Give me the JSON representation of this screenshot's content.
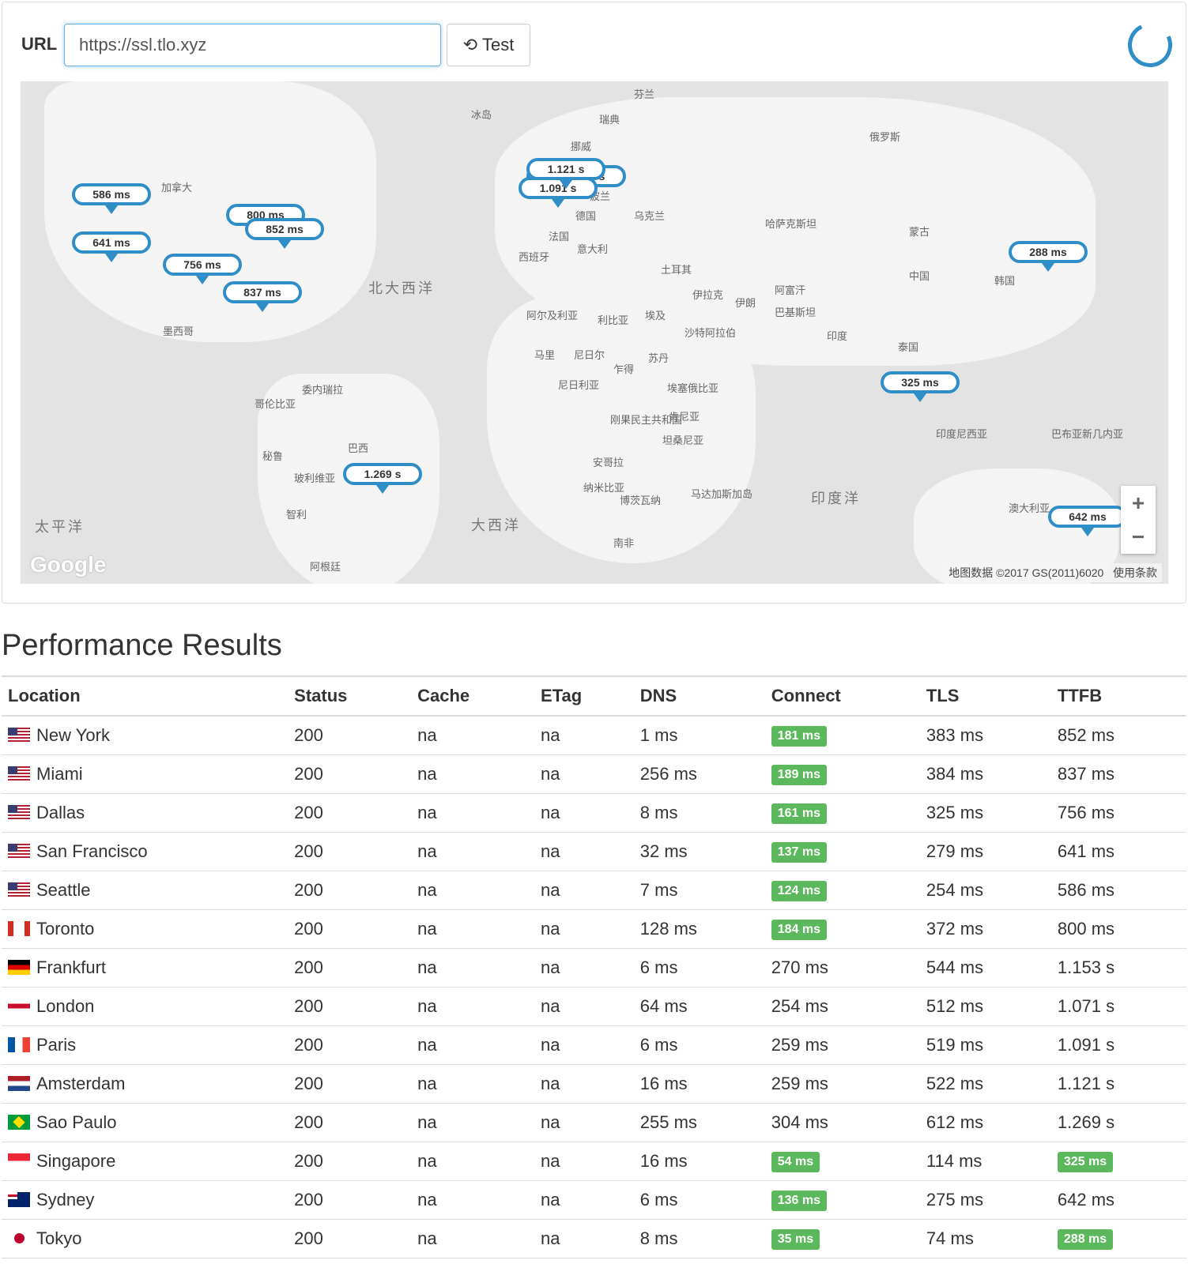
{
  "toolbar": {
    "url_label": "URL",
    "url_value": "https://ssl.tlo.xyz",
    "test_label": "Test",
    "test_icon": "history-icon",
    "loading_icon": "spinner"
  },
  "map": {
    "markers": [
      "586 ms",
      "641 ms",
      "800 ms",
      "852 ms",
      "756 ms",
      "837 ms",
      "1.153 s",
      "1.071 s",
      "1.091 s",
      "1.121 s",
      "1.269 s",
      "325 ms",
      "288 ms",
      "642 ms"
    ],
    "labels": [
      "冰岛",
      "芬兰",
      "瑞典",
      "挪威",
      "俄罗斯",
      "加拿大",
      "德国",
      "法国",
      "波兰",
      "乌克兰",
      "西班牙",
      "意大利",
      "土耳其",
      "哈萨克斯坦",
      "蒙古",
      "中国",
      "韩国",
      "伊拉克",
      "伊朗",
      "阿富汗",
      "巴基斯坦",
      "印度",
      "泰国",
      "阿尔及利亚",
      "利比亚",
      "埃及",
      "沙特阿拉伯",
      "马里",
      "尼日尔",
      "乍得",
      "苏丹",
      "尼日利亚",
      "埃塞俄比亚",
      "刚果民主共和国",
      "肯尼亚",
      "坦桑尼亚",
      "安哥拉",
      "纳米比亚",
      "博茨瓦纳",
      "南非",
      "马达加斯加岛",
      "印度尼西亚",
      "巴布亚新几内亚",
      "澳大利亚",
      "墨西哥",
      "委内瑞拉",
      "哥伦比亚",
      "巴西",
      "秘鲁",
      "玻利维亚",
      "智利",
      "阿根廷"
    ],
    "oceans": [
      "北大西洋",
      "太平洋",
      "大西洋",
      "印度洋"
    ],
    "zoom_in": "+",
    "zoom_out": "−",
    "logo": "Google",
    "attribution": "地图数据 ©2017 GS(2011)6020",
    "terms": "使用条款",
    "accent": "#2f8dc8"
  },
  "results": {
    "title": "Performance Results",
    "columns": [
      "Location",
      "Status",
      "Cache",
      "ETag",
      "DNS",
      "Connect",
      "TLS",
      "TTFB"
    ],
    "highlight_color": "#5cb85c",
    "rows": [
      {
        "flag": "us",
        "location": "New York",
        "status": "200",
        "cache": "na",
        "etag": "na",
        "dns": "1 ms",
        "connect": "181 ms",
        "connect_hl": true,
        "tls": "383 ms",
        "ttfb": "852 ms",
        "ttfb_hl": false
      },
      {
        "flag": "us",
        "location": "Miami",
        "status": "200",
        "cache": "na",
        "etag": "na",
        "dns": "256 ms",
        "connect": "189 ms",
        "connect_hl": true,
        "tls": "384 ms",
        "ttfb": "837 ms",
        "ttfb_hl": false
      },
      {
        "flag": "us",
        "location": "Dallas",
        "status": "200",
        "cache": "na",
        "etag": "na",
        "dns": "8 ms",
        "connect": "161 ms",
        "connect_hl": true,
        "tls": "325 ms",
        "ttfb": "756 ms",
        "ttfb_hl": false
      },
      {
        "flag": "us",
        "location": "San Francisco",
        "status": "200",
        "cache": "na",
        "etag": "na",
        "dns": "32 ms",
        "connect": "137 ms",
        "connect_hl": true,
        "tls": "279 ms",
        "ttfb": "641 ms",
        "ttfb_hl": false
      },
      {
        "flag": "us",
        "location": "Seattle",
        "status": "200",
        "cache": "na",
        "etag": "na",
        "dns": "7 ms",
        "connect": "124 ms",
        "connect_hl": true,
        "tls": "254 ms",
        "ttfb": "586 ms",
        "ttfb_hl": false
      },
      {
        "flag": "ca",
        "location": "Toronto",
        "status": "200",
        "cache": "na",
        "etag": "na",
        "dns": "128 ms",
        "connect": "184 ms",
        "connect_hl": true,
        "tls": "372 ms",
        "ttfb": "800 ms",
        "ttfb_hl": false
      },
      {
        "flag": "de",
        "location": "Frankfurt",
        "status": "200",
        "cache": "na",
        "etag": "na",
        "dns": "6 ms",
        "connect": "270 ms",
        "connect_hl": false,
        "tls": "544 ms",
        "ttfb": "1.153 s",
        "ttfb_hl": false
      },
      {
        "flag": "gb",
        "location": "London",
        "status": "200",
        "cache": "na",
        "etag": "na",
        "dns": "64 ms",
        "connect": "254 ms",
        "connect_hl": false,
        "tls": "512 ms",
        "ttfb": "1.071 s",
        "ttfb_hl": false
      },
      {
        "flag": "fr",
        "location": "Paris",
        "status": "200",
        "cache": "na",
        "etag": "na",
        "dns": "6 ms",
        "connect": "259 ms",
        "connect_hl": false,
        "tls": "519 ms",
        "ttfb": "1.091 s",
        "ttfb_hl": false
      },
      {
        "flag": "nl",
        "location": "Amsterdam",
        "status": "200",
        "cache": "na",
        "etag": "na",
        "dns": "16 ms",
        "connect": "259 ms",
        "connect_hl": false,
        "tls": "522 ms",
        "ttfb": "1.121 s",
        "ttfb_hl": false
      },
      {
        "flag": "br",
        "location": "Sao Paulo",
        "status": "200",
        "cache": "na",
        "etag": "na",
        "dns": "255 ms",
        "connect": "304 ms",
        "connect_hl": false,
        "tls": "612 ms",
        "ttfb": "1.269 s",
        "ttfb_hl": false
      },
      {
        "flag": "sg",
        "location": "Singapore",
        "status": "200",
        "cache": "na",
        "etag": "na",
        "dns": "16 ms",
        "connect": "54 ms",
        "connect_hl": true,
        "tls": "114 ms",
        "ttfb": "325 ms",
        "ttfb_hl": true
      },
      {
        "flag": "au",
        "location": "Sydney",
        "status": "200",
        "cache": "na",
        "etag": "na",
        "dns": "6 ms",
        "connect": "136 ms",
        "connect_hl": true,
        "tls": "275 ms",
        "ttfb": "642 ms",
        "ttfb_hl": false
      },
      {
        "flag": "jp",
        "location": "Tokyo",
        "status": "200",
        "cache": "na",
        "etag": "na",
        "dns": "8 ms",
        "connect": "35 ms",
        "connect_hl": true,
        "tls": "74 ms",
        "ttfb": "288 ms",
        "ttfb_hl": true
      }
    ]
  }
}
